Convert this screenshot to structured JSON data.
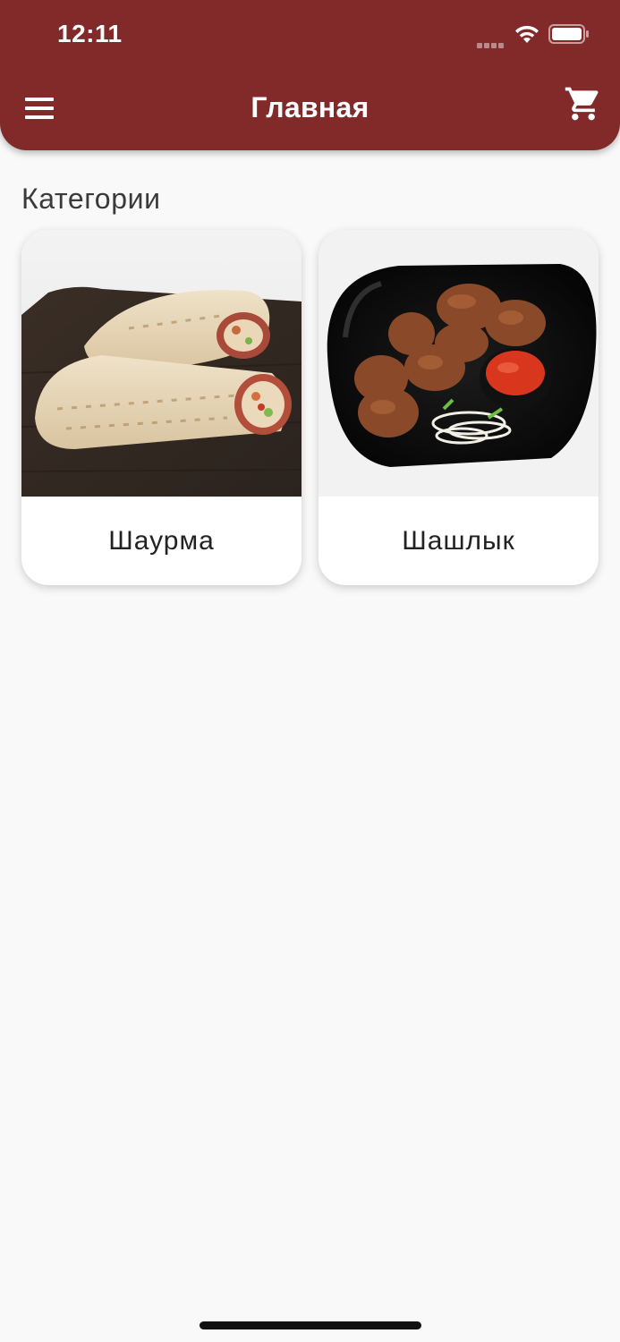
{
  "status_bar": {
    "time": "12:11"
  },
  "header": {
    "title": "Главная",
    "menu_icon": "menu-icon",
    "cart_icon": "cart-icon"
  },
  "colors": {
    "header": "#822a2a",
    "background": "#f9f9f9",
    "card": "#ffffff"
  },
  "main": {
    "section_title": "Категории",
    "categories": [
      {
        "label": "Шаурма",
        "image": "shawarma-rolls-on-wooden-board"
      },
      {
        "label": "Шашлык",
        "image": "grilled-meat-skewers-on-black-plate-with-sauce"
      }
    ]
  }
}
